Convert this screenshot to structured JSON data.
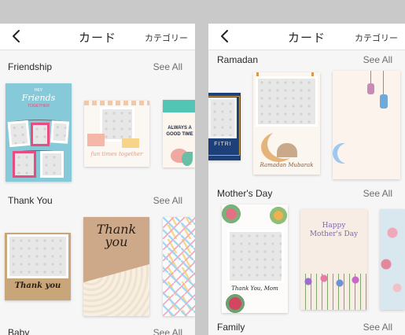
{
  "left": {
    "header": {
      "title": "カード",
      "category": "カテゴリー"
    },
    "sections": [
      {
        "title": "Friendship",
        "see_all": "See All"
      },
      {
        "title": "Thank You",
        "see_all": "See All"
      },
      {
        "title": "Baby",
        "see_all": "See All"
      }
    ],
    "cards": {
      "friends_small": "HEY",
      "friends_big": "Friends",
      "friends_sub": "TOGETHER",
      "fun_times": "fun times together",
      "always_good": "ALWAYS A GOOD TIME",
      "thank_you_script": "Thank you",
      "thank_you_big": "Thank you"
    }
  },
  "right": {
    "header": {
      "title": "カード",
      "category": "カテゴリー"
    },
    "sections": [
      {
        "title": "Ramadan",
        "see_all": "See All"
      },
      {
        "title": "Mother's Day",
        "see_all": "See All"
      },
      {
        "title": "Family",
        "see_all": "See All"
      }
    ],
    "cards": {
      "fitri": "FITRI",
      "ramadan_mubarak": "Ramadan Mubarak",
      "thank_you_mom": "Thank You, Mom",
      "happy_mothers_day": "Happy Mother's Day"
    }
  },
  "colors": {
    "background": "#c9c9c9",
    "panel": "#f6f6f6",
    "header": "#ffffff",
    "friends_card": "#86c9d8",
    "kraft": "#c9a67a",
    "navy": "#1d3f7a",
    "crescent": "#9ec8ee"
  },
  "icons": [
    "chevron-left-icon",
    "photo-placeholder-icon"
  ]
}
